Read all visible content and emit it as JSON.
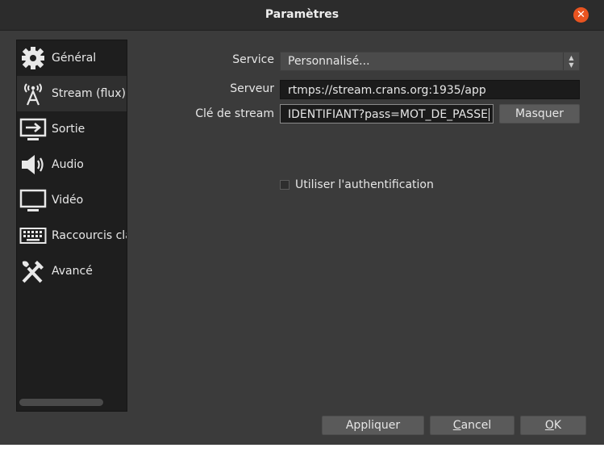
{
  "window": {
    "title": "Paramètres"
  },
  "titlebar": {
    "close_glyph": "✕"
  },
  "sidebar": {
    "items": [
      {
        "label": "Général",
        "icon": "gear-icon"
      },
      {
        "label": "Stream (flux)",
        "icon": "broadcast-antenna-icon",
        "selected": true
      },
      {
        "label": "Sortie",
        "icon": "output-monitor-icon"
      },
      {
        "label": "Audio",
        "icon": "speaker-icon"
      },
      {
        "label": "Vidéo",
        "icon": "display-icon"
      },
      {
        "label": "Raccourcis cla",
        "icon": "keyboard-icon"
      },
      {
        "label": "Avancé",
        "icon": "tools-icon"
      }
    ]
  },
  "stream": {
    "service_label": "Service",
    "service_value": "Personnalisé...",
    "server_label": "Serveur",
    "server_value": "rtmps://stream.crans.org:1935/app",
    "key_label": "Clé de stream",
    "key_value": "IDENTIFIANT?pass=MOT_DE_PASSE",
    "hide_button": "Masquer",
    "auth_label": "Utiliser l'authentification",
    "auth_checked": false
  },
  "footer": {
    "apply": "Appliquer",
    "cancel_first": "C",
    "cancel_rest": "ancel",
    "ok_first": "O",
    "ok_rest": "K"
  },
  "colors": {
    "accent": "#e95420",
    "background": "#3b3b3b",
    "sidebar": "#1e1e1e"
  }
}
